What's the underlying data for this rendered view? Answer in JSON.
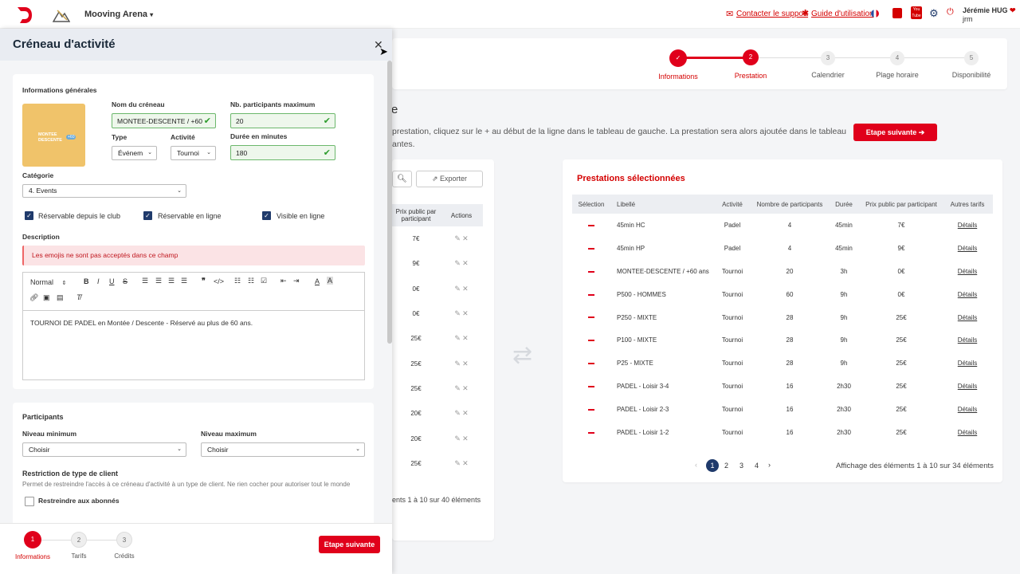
{
  "topbar": {
    "arena": "Mooving Arena",
    "support": "Contacter le support",
    "guide": "Guide d'utilisation",
    "user_name": "Jérémie HUG",
    "user_sub": "jrm",
    "accent": "#e0001b"
  },
  "wizard": {
    "steps": [
      {
        "num": "✓",
        "label": "Informations"
      },
      {
        "num": "2",
        "label": "Prestation"
      },
      {
        "num": "3",
        "label": "Calendrier"
      },
      {
        "num": "4",
        "label": "Plage horaire"
      },
      {
        "num": "5",
        "label": "Disponibilité"
      }
    ],
    "heading_fragment": "e",
    "instructions_line1": "prestation, cliquez sur le + au début de la ligne dans le tableau de gauche. La prestation sera alors ajoutée dans le tableau",
    "instructions_line2": "antes.",
    "next_button": "Etape suivante ➔"
  },
  "left_table": {
    "export": "Exporter",
    "col_price": "Prix public par participant",
    "col_actions": "Actions",
    "prices": [
      "7€",
      "9€",
      "0€",
      "0€",
      "25€",
      "25€",
      "25€",
      "20€",
      "20€",
      "25€"
    ],
    "footer": "ents 1 à 10 sur 40 éléments"
  },
  "selected": {
    "title": "Prestations sélectionnées",
    "headers": [
      "Sélection",
      "Libellé",
      "Activité",
      "Nombre de participants",
      "Durée",
      "Prix public par participant",
      "Autres tarifs"
    ],
    "rows": [
      {
        "label": "45min HC",
        "activity": "Padel",
        "participants": "4",
        "duration": "45min",
        "price": "7€",
        "link": "Détails"
      },
      {
        "label": "45min HP",
        "activity": "Padel",
        "participants": "4",
        "duration": "45min",
        "price": "9€",
        "link": "Détails"
      },
      {
        "label": "MONTEE-DESCENTE / +60 ans",
        "activity": "Tournoi",
        "participants": "20",
        "duration": "3h",
        "price": "0€",
        "link": "Détails"
      },
      {
        "label": "P500 - HOMMES",
        "activity": "Tournoi",
        "participants": "60",
        "duration": "9h",
        "price": "0€",
        "link": "Détails"
      },
      {
        "label": "P250 - MIXTE",
        "activity": "Tournoi",
        "participants": "28",
        "duration": "9h",
        "price": "25€",
        "link": "Détails"
      },
      {
        "label": "P100 - MIXTE",
        "activity": "Tournoi",
        "participants": "28",
        "duration": "9h",
        "price": "25€",
        "link": "Détails"
      },
      {
        "label": "P25 - MIXTE",
        "activity": "Tournoi",
        "participants": "28",
        "duration": "9h",
        "price": "25€",
        "link": "Détails"
      },
      {
        "label": "PADEL - Loisir 3-4",
        "activity": "Tournoi",
        "participants": "16",
        "duration": "2h30",
        "price": "25€",
        "link": "Détails"
      },
      {
        "label": "PADEL - Loisir 2-3",
        "activity": "Tournoi",
        "participants": "16",
        "duration": "2h30",
        "price": "25€",
        "link": "Détails"
      },
      {
        "label": "PADEL - Loisir 1-2",
        "activity": "Tournoi",
        "participants": "16",
        "duration": "2h30",
        "price": "25€",
        "link": "Détails"
      }
    ],
    "pages": [
      "1",
      "2",
      "3",
      "4"
    ],
    "prev": "‹",
    "next": "›",
    "footer": "Affichage des éléments 1 à 10 sur 34 éléments"
  },
  "modal": {
    "title": "Créneau d'activité",
    "general_title": "Informations générales",
    "image_text": "MONTEE DESCENTE",
    "image_badge": "+60",
    "name_label": "Nom du créneau",
    "name_value": "MONTEE-DESCENTE / +60",
    "max_label": "Nb. participants maximum",
    "max_value": "20",
    "type_label": "Type",
    "type_value": "Événem",
    "activity_label": "Activité",
    "activity_value": "Tournoi",
    "duration_label": "Durée en minutes",
    "duration_value": "180",
    "category_label": "Catégorie",
    "category_value": "4. Events",
    "check1": "Réservable depuis le club",
    "check2": "Réservable en ligne",
    "check3": "Visible en ligne",
    "desc_label": "Description",
    "alert": "Les emojis ne sont pas acceptés dans ce champ",
    "format_value": "Normal",
    "desc_text": "TOURNOI DE PADEL en Montée / Descente - Réservé au plus de 60 ans.",
    "participants_title": "Participants",
    "min_label": "Niveau minimum",
    "min_value": "Choisir",
    "maxlvl_label": "Niveau maximum",
    "maxlvl_value": "Choisir",
    "restriction_title": "Restriction de type de client",
    "restriction_desc": "Permet de restreindre l'accès à ce créneau d'activité à un type de client. Ne rien cocher pour autoriser tout le monde",
    "restriction_check": "Restreindre aux abonnés",
    "footer_steps": [
      {
        "num": "1",
        "label": "Informations"
      },
      {
        "num": "2",
        "label": "Tarifs"
      },
      {
        "num": "3",
        "label": "Crédits"
      }
    ],
    "next_button": "Etape suivante"
  }
}
